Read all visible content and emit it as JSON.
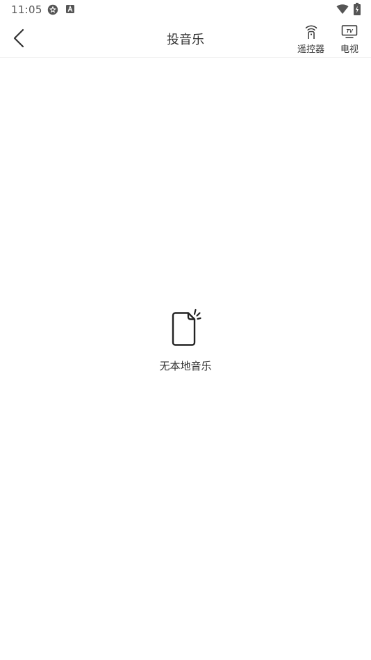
{
  "status_bar": {
    "time": "11:05",
    "icons": [
      "settings-app-icon",
      "a-badge-icon",
      "wifi-icon",
      "battery-icon"
    ]
  },
  "header": {
    "title": "投音乐",
    "back_icon": "chevron-left-icon",
    "remote": {
      "label": "遥控器",
      "icon": "remote-icon"
    },
    "tv": {
      "label": "电视",
      "icon": "tv-icon"
    }
  },
  "empty_state": {
    "icon": "empty-file-icon",
    "message": "无本地音乐"
  }
}
